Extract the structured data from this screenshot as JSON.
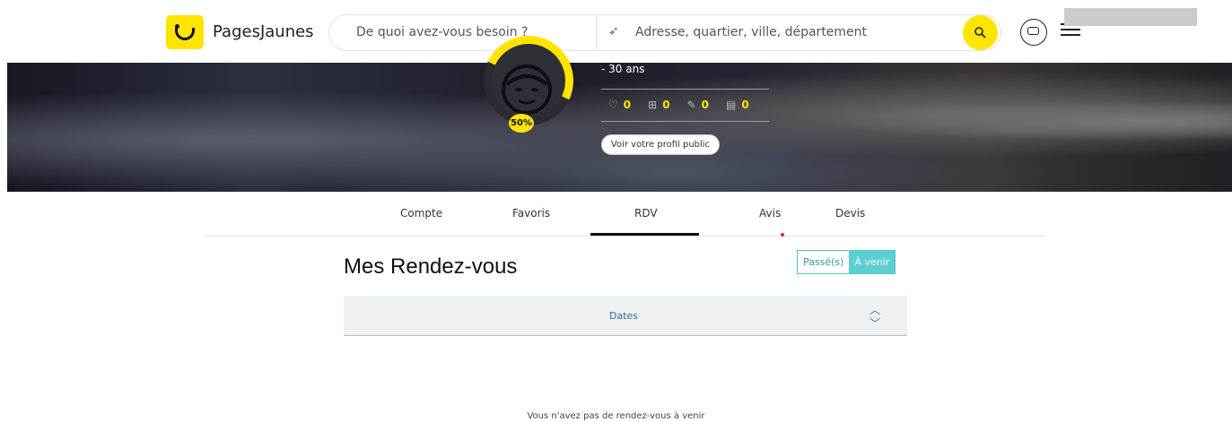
{
  "header": {
    "logo_text": "PagesJaunes",
    "search_what_placeholder": "De quoi avez-vous besoin ?",
    "search_where_placeholder": "Adresse, quartier, ville, département",
    "brand_color": "#ffe400"
  },
  "profile": {
    "age": "- 30 ans",
    "completion": "50%",
    "stats": [
      {
        "icon": "heart-icon",
        "value": "0"
      },
      {
        "icon": "plus-box-icon",
        "value": "0"
      },
      {
        "icon": "pencil-icon",
        "value": "0"
      },
      {
        "icon": "document-icon",
        "value": "0"
      }
    ],
    "public_profile_button": "Voir votre profil public"
  },
  "tabs": [
    {
      "label": "Compte"
    },
    {
      "label": "Favoris"
    },
    {
      "label": "RDV",
      "active": true
    },
    {
      "label": "Avis"
    },
    {
      "label": "Devis"
    }
  ],
  "main": {
    "title": "Mes Rendez-vous",
    "toggle_past": "Passé(s)",
    "toggle_upcoming": "À venir",
    "dates_label": "Dates",
    "empty_message": "Vous n'avez pas de rendez-vous à venir"
  }
}
